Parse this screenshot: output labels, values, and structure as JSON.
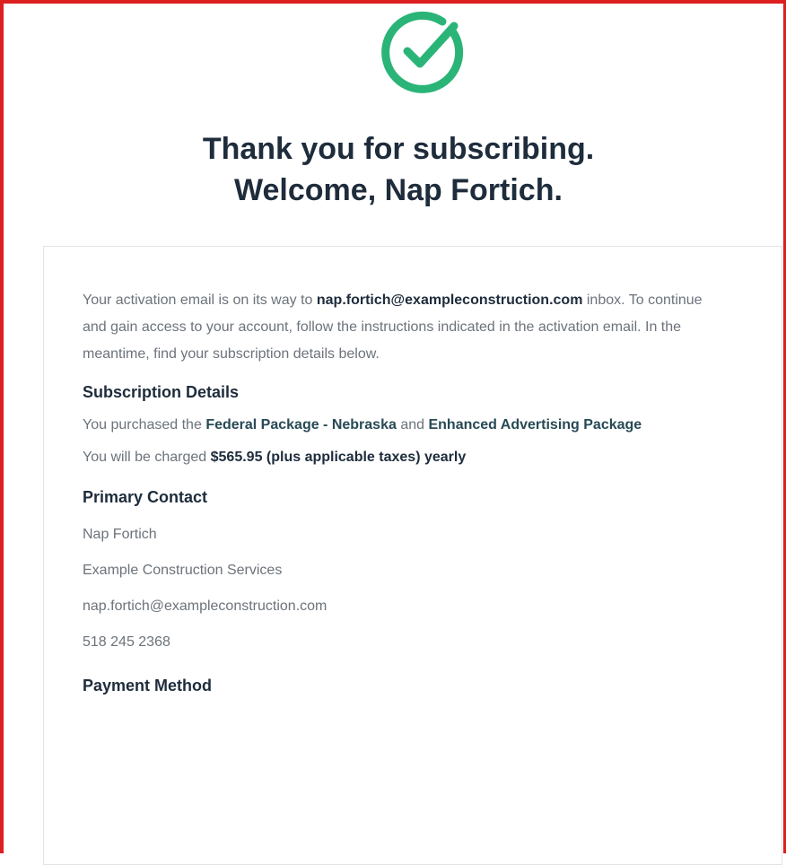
{
  "colors": {
    "accent_green": "#2bb477",
    "heading": "#1e2c3c",
    "body_text": "#6c737b",
    "frame_red": "#dd1f1f"
  },
  "status_icon": "check-circle-icon",
  "header": {
    "line1": "Thank you for subscribing.",
    "line2": "Welcome, Nap Fortich."
  },
  "intro": {
    "prefix": "Your activation email is on its way to",
    "email": "nap.fortich@exampleconstruction.com",
    "suffix": "inbox. To continue and gain access to your account, follow the instructions indicated in the activation email. In the meantime, find your subscription details below."
  },
  "subscription": {
    "title": "Subscription Details",
    "purchased_prefix": "You purchased the",
    "package1": "Federal Package - Nebraska",
    "and": "and",
    "package2": "Enhanced Advertising Package",
    "charge_prefix": "You will be charged",
    "charge_amount": "$565.95 (plus applicable taxes) yearly"
  },
  "primary_contact": {
    "title": "Primary Contact",
    "name": "Nap Fortich",
    "company": "Example Construction Services",
    "email": "nap.fortich@exampleconstruction.com",
    "phone": "518 245 2368"
  },
  "payment": {
    "title": "Payment Method"
  }
}
